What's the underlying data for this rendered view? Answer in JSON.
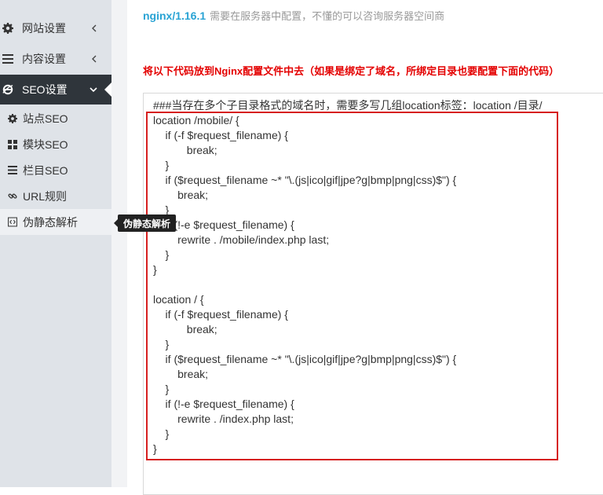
{
  "sidebar": {
    "items": [
      {
        "label": "网站设置",
        "icon": "gear-icon"
      },
      {
        "label": "内容设置",
        "icon": "list-icon"
      },
      {
        "label": "SEO设置",
        "icon": "ie-icon"
      }
    ],
    "sub_items": [
      {
        "label": "站点SEO",
        "icon": "gear-icon"
      },
      {
        "label": "模块SEO",
        "icon": "grid-icon"
      },
      {
        "label": "栏目SEO",
        "icon": "list-icon"
      },
      {
        "label": "URL规则",
        "icon": "link-icon"
      },
      {
        "label": "伪静态解析",
        "icon": "code-icon"
      }
    ],
    "tooltip": "伪静态解析"
  },
  "main": {
    "version": "nginx/1.16.1",
    "version_hint": "需要在服务器中配置，不懂的可以咨询服务器空间商",
    "notice": "将以下代码放到Nginx配置文件中去（如果是绑定了域名，所绑定目录也要配置下面的代码）",
    "code": "###当存在多个子目录格式的域名时，需要多写几组location标签：location /目录/\nlocation /mobile/ {\n    if (-f $request_filename) {\n           break;\n    }\n    if ($request_filename ~* \"\\.(js|ico|gif|jpe?g|bmp|png|css)$\") {\n        break;\n    }\n    if (!-e $request_filename) {\n        rewrite . /mobile/index.php last;\n    }\n}\n\nlocation / {\n    if (-f $request_filename) {\n           break;\n    }\n    if ($request_filename ~* \"\\.(js|ico|gif|jpe?g|bmp|png|css)$\") {\n        break;\n    }\n    if (!-e $request_filename) {\n        rewrite . /index.php last;\n    }\n}"
  }
}
